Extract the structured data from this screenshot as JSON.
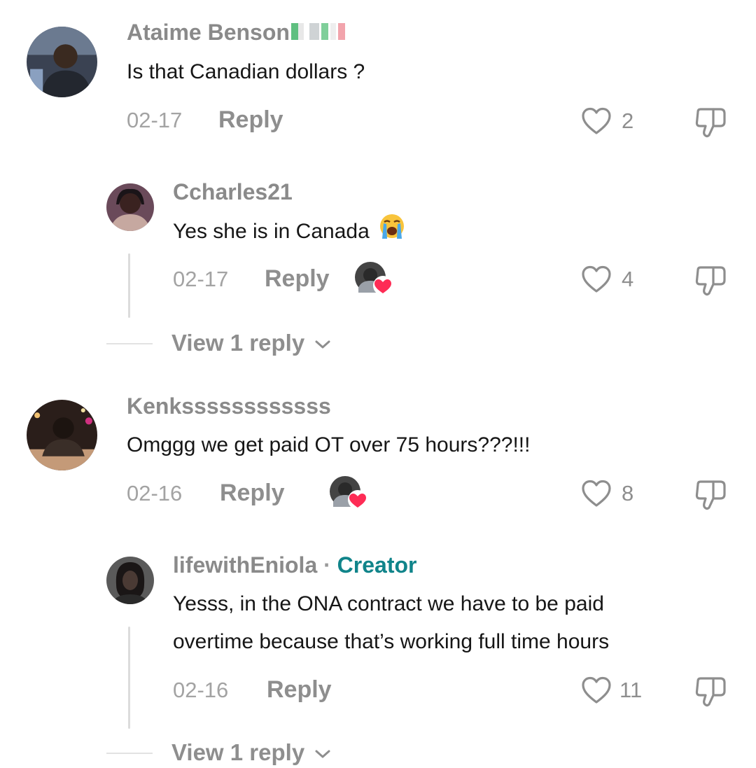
{
  "comments": [
    {
      "username": "Ataime Benson",
      "text": "Is that Canadian dollars ?",
      "date": "02-17",
      "reply_label": "Reply",
      "likes": "2"
    },
    {
      "username": "Ccharles21",
      "text": "Yes she is in Canada",
      "date": "02-17",
      "reply_label": "Reply",
      "likes": "4",
      "view_replies": "View 1 reply"
    },
    {
      "username": "Kenkssssssssssss",
      "text": "Omggg we get paid OT over 75 hours???!!!",
      "date": "02-16",
      "reply_label": "Reply",
      "likes": "8"
    },
    {
      "username": "lifewithEniola",
      "separator": "·",
      "badge": "Creator",
      "text_line1": "Yesss, in the ONA contract we have to be paid",
      "text_line2": "overtime because that’s working full time hours",
      "date": "02-16",
      "reply_label": "Reply",
      "likes": "11",
      "view_replies": "View 1 reply"
    }
  ],
  "colors": {
    "username": "#8a8a8a",
    "creator_badge": "#10848a",
    "heart_badge": "#fe2c55",
    "icon_stroke": "#8e8e8e"
  },
  "icons": [
    "heart-outline-icon",
    "dislike-icon",
    "chevron-down-icon",
    "loudly-crying-face-emoji",
    "creator-liked-heart-icon",
    "flag-emoji"
  ]
}
